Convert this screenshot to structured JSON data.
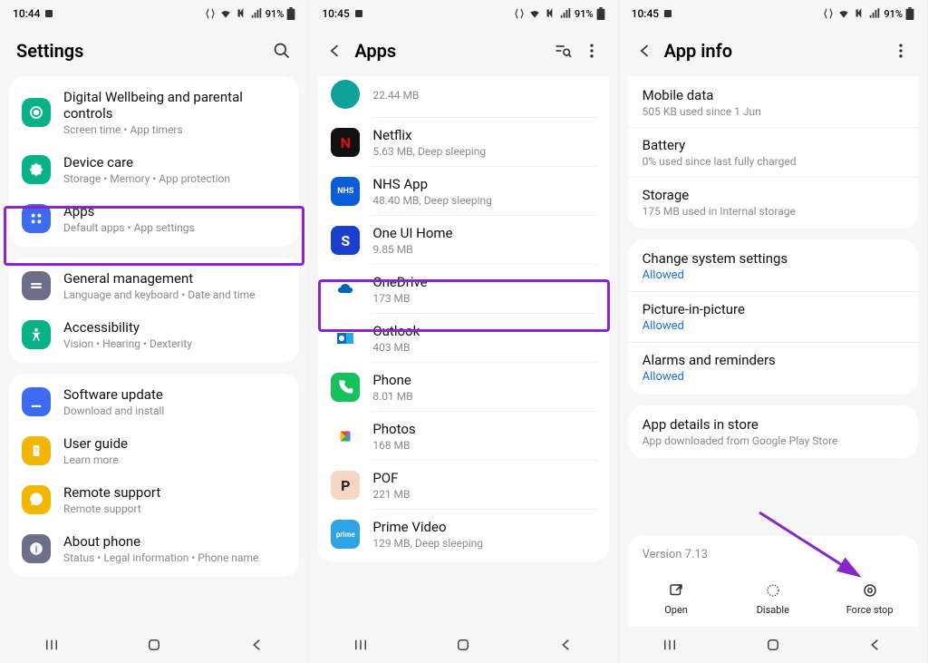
{
  "status": {
    "time1": "10:44",
    "time2": "10:45",
    "time3": "10:45",
    "battery": "91%"
  },
  "panel1": {
    "title": "Settings",
    "groups": [
      {
        "items": [
          {
            "title": "Digital Wellbeing and parental controls",
            "sub": "Screen time  •  App timers",
            "icon": "wellbeing",
            "bg": "#07b386"
          },
          {
            "title": "Device care",
            "sub": "Storage  •  Memory  •  App protection",
            "icon": "devicecare",
            "bg": "#07b386"
          },
          {
            "title": "Apps",
            "sub": "Default apps  •  App settings",
            "icon": "apps",
            "bg": "#3d6af2"
          }
        ]
      },
      {
        "items": [
          {
            "title": "General management",
            "sub": "Language and keyboard  •  Date and time",
            "icon": "general",
            "bg": "#6b6f8a"
          },
          {
            "title": "Accessibility",
            "sub": "Vision  •  Hearing  •  Dexterity",
            "icon": "accessibility",
            "bg": "#07b386"
          }
        ]
      },
      {
        "items": [
          {
            "title": "Software update",
            "sub": "Download and install",
            "icon": "update",
            "bg": "#3d6af2"
          },
          {
            "title": "User guide",
            "sub": "Learn more",
            "icon": "guide",
            "bg": "#f2b705"
          },
          {
            "title": "Remote support",
            "sub": "Remote support",
            "icon": "remote",
            "bg": "#f2b705"
          },
          {
            "title": "About phone",
            "sub": "Status  •  Legal information  •  Phone name",
            "icon": "about",
            "bg": "#6b6f8a"
          }
        ]
      }
    ]
  },
  "panel2": {
    "title": "Apps",
    "apps": [
      {
        "title": "",
        "sub": "22.44 MB",
        "bg": "#0fa09a",
        "glyph": ""
      },
      {
        "title": "Netflix",
        "sub": "5.63 MB, Deep sleeping",
        "bg": "#111",
        "glyph": "N",
        "glyphColor": "#e50914"
      },
      {
        "title": "NHS App",
        "sub": "48.40 MB, Deep sleeping",
        "bg": "#0b5cd8",
        "glyph": "NHS",
        "glyphSize": "9px"
      },
      {
        "title": "One UI Home",
        "sub": "9.85 MB",
        "bg": "#1a3fcf",
        "glyph": "S"
      },
      {
        "title": "OneDrive",
        "sub": "173 MB",
        "bg": "#fff",
        "svg": "onedrive"
      },
      {
        "title": "Outlook",
        "sub": "403 MB",
        "bg": "#fff",
        "svg": "outlook"
      },
      {
        "title": "Phone",
        "sub": "8.01 MB",
        "bg": "#17c15d",
        "svg": "phone"
      },
      {
        "title": "Photos",
        "sub": "168 MB",
        "bg": "#fff",
        "svg": "photos"
      },
      {
        "title": "POF",
        "sub": "221 MB",
        "bg": "#f7d6c5",
        "glyph": "P",
        "glyphColor": "#222"
      },
      {
        "title": "Prime Video",
        "sub": "129 MB, Deep sleeping",
        "bg": "#2ea3e6",
        "glyph": "prime",
        "glyphSize": "8px"
      }
    ]
  },
  "panel3": {
    "title": "App info",
    "usage": [
      {
        "title": "Mobile data",
        "sub": "505 KB used since 1 Jun"
      },
      {
        "title": "Battery",
        "sub": "0% used since last fully charged"
      },
      {
        "title": "Storage",
        "sub": "175 MB used in Internal storage"
      }
    ],
    "perms": [
      {
        "title": "Change system settings",
        "link": "Allowed"
      },
      {
        "title": "Picture-in-picture",
        "link": "Allowed"
      },
      {
        "title": "Alarms and reminders",
        "link": "Allowed"
      }
    ],
    "store": {
      "title": "App details in store",
      "sub": "App downloaded from Google Play Store"
    },
    "version": "Version 7.13",
    "actions": {
      "open": "Open",
      "disable": "Disable",
      "forcestop": "Force stop"
    }
  }
}
